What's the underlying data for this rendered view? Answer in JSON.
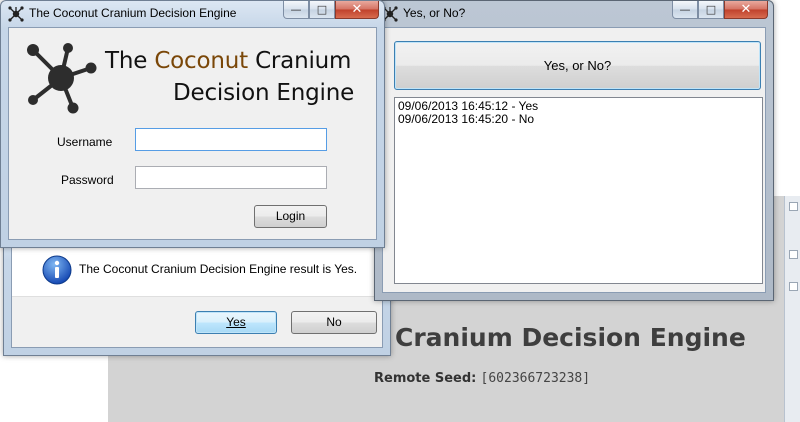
{
  "browser": {
    "page_heading": "Cranium Decision Engine",
    "seed_label": "Remote Seed:",
    "seed_value": "[602366723238]"
  },
  "message_box": {
    "text": "The Coconut Cranium Decision Engine result is Yes.",
    "icon": "information-icon",
    "yes_label": "Yes",
    "no_label": "No"
  },
  "login_window": {
    "title": "The Coconut Cranium Decision Engine",
    "logo": {
      "word_the": "The",
      "word_coconut": "Coconut",
      "word_cranium": "Cranium",
      "line2": "Decision Engine",
      "accent_color": "#7a4708"
    },
    "username_label": "Username",
    "username_value": "",
    "password_label": "Password",
    "password_value": "",
    "login_label": "Login"
  },
  "yesno_window": {
    "title": "Yes, or No?",
    "button_label": "Yes, or No?",
    "log": [
      "09/06/2013 16:45:12 - Yes",
      "09/06/2013 16:45:20 - No"
    ]
  },
  "caption_buttons": {
    "minimize": "—",
    "maximize": "□",
    "close": "✕"
  }
}
